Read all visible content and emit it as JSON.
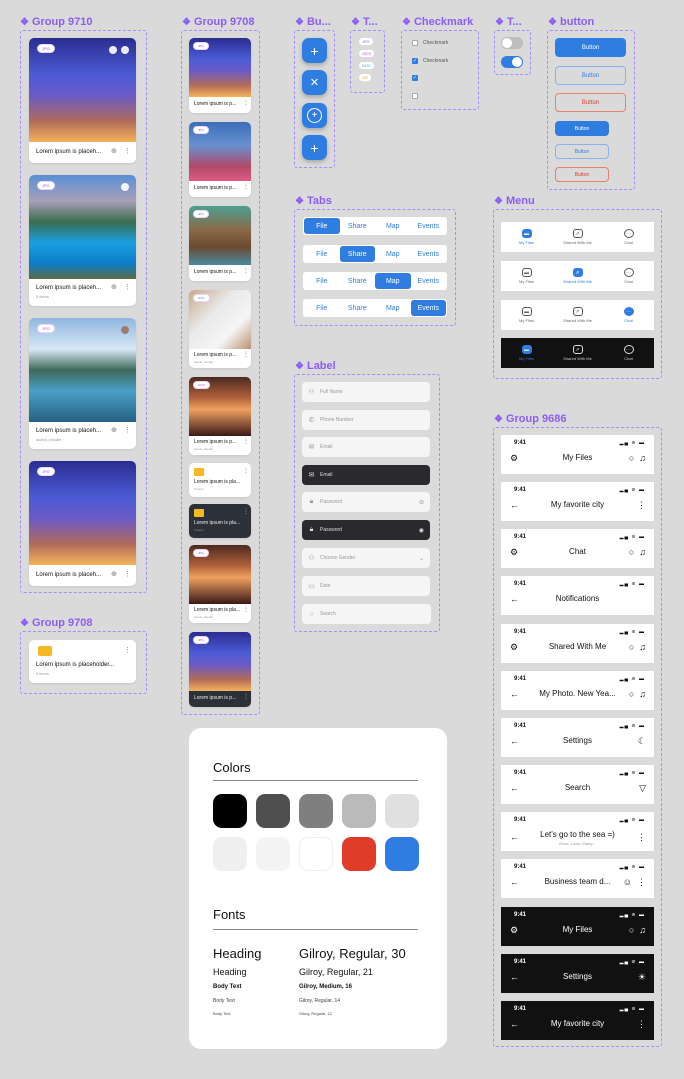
{
  "groups": {
    "g9710": "Group 9710",
    "g9708a": "Group 9708",
    "g9708b": "Group 9708",
    "buttons_fab": "Bu...",
    "tags": "T...",
    "checkmark": "Checkmark",
    "toggles": "T...",
    "button": "button",
    "tabs": "Tabs",
    "menu": "Menu",
    "label": "Label",
    "g9686": "Group 9686"
  },
  "large_cards": [
    {
      "tag": "JPG",
      "caption": "Lorem ipsum is placeh...",
      "sub": ""
    },
    {
      "tag": "JPG",
      "caption": "Lorem ipsum is placeh...",
      "sub": "5 items"
    },
    {
      "tag": "JPG",
      "caption": "Lorem ipsum is placeh...",
      "sub": "avana_baoder"
    },
    {
      "tag": "JPG",
      "caption": "Lorem ipsum is placeh...",
      "sub": ""
    }
  ],
  "folder_card": {
    "caption": "Lorem ipsum is placeholder...",
    "sub": "5 items"
  },
  "small_cards": [
    {
      "tag": "JPG",
      "caption": "Lorem ipsum is p..."
    },
    {
      "tag": "JPG",
      "caption": "Lorem ipsum is p..."
    },
    {
      "tag": "JPG",
      "caption": "Lorem ipsum is p..."
    },
    {
      "tag": "DOC",
      "caption": "Lorem ipsum is p...",
      "sub": "avana_baoder"
    },
    {
      "tag": "GIFS",
      "caption": "Lorem ipsum is p...",
      "sub": "avana_baoder"
    },
    {
      "caption": "Lorem ipsum is pla...",
      "sub": "5 items"
    },
    {
      "caption": "Lorem ipsum is pla...",
      "sub": "3 items"
    },
    {
      "tag": "JPG",
      "caption": "Lorem ipsum is pla...",
      "sub": "avana_baoder"
    },
    {
      "tag": "JPG",
      "caption": "Lorem ipsum is p..."
    }
  ],
  "tag_chips": [
    {
      "label": "JPG",
      "color": "#8b5cf6"
    },
    {
      "label": "GIFS",
      "color": "#d946ef"
    },
    {
      "label": "DOC",
      "color": "#3b9ae1"
    },
    {
      "label": "ZIP",
      "color": "#eab308"
    }
  ],
  "checkmarks": [
    {
      "label": "Checkmark",
      "checked": false
    },
    {
      "label": "Checkmark",
      "checked": true
    },
    {
      "label": "",
      "checked": true
    },
    {
      "label": "",
      "checked": false
    }
  ],
  "toggles": [
    {
      "on": false
    },
    {
      "on": true
    }
  ],
  "buttons": {
    "label": "Button"
  },
  "tabs": [
    "File",
    "Share",
    "Map",
    "Events"
  ],
  "fields": [
    {
      "placeholder": "Full Name",
      "icon": "user-icon"
    },
    {
      "placeholder": "Phone Number",
      "icon": "phone-icon"
    },
    {
      "placeholder": "Email",
      "icon": "mail-icon"
    },
    {
      "placeholder": "Email",
      "icon": "mail-icon",
      "dark": true
    },
    {
      "placeholder": "Password",
      "icon": "lock-icon"
    },
    {
      "placeholder": "Password",
      "icon": "lock-icon",
      "dark": true
    },
    {
      "placeholder": "Choose Gender",
      "icon": "gender-icon"
    },
    {
      "placeholder": "Date",
      "icon": "calendar-icon"
    },
    {
      "placeholder": "Search",
      "icon": "search-icon"
    }
  ],
  "menu": [
    "My Files",
    "Shared With Me",
    "Chat"
  ],
  "headers": [
    {
      "time": "9:41",
      "title": "My Files"
    },
    {
      "time": "9:41",
      "title": "My favorite city"
    },
    {
      "time": "9:41",
      "title": "Chat"
    },
    {
      "time": "9:41",
      "title": "Notifications"
    },
    {
      "time": "9:41",
      "title": "Shared With Me"
    },
    {
      "time": "9:41",
      "title": "My Photo. New Yea..."
    },
    {
      "time": "9:41",
      "title": "Settings"
    },
    {
      "time": "9:41",
      "title": "Search"
    },
    {
      "time": "9:41",
      "title": "Let's go to the sea =)",
      "subtitle": "Esna, Louis, Marry..."
    },
    {
      "time": "9:41",
      "title": "Business team d..."
    },
    {
      "time": "9:41",
      "title": "My Files"
    },
    {
      "time": "9:41",
      "title": "Settings"
    },
    {
      "time": "9:41",
      "title": "My favorite city"
    }
  ],
  "styleguide": {
    "colors_title": "Colors",
    "colors": [
      "#000000",
      "#4f4f4f",
      "#7f7f7f",
      "#bababa",
      "#e0e0e0",
      "#efefef",
      "#f4f4f4",
      "#ffffff",
      "#e03c2a",
      "#2f7de1"
    ],
    "fonts_title": "Fonts",
    "fonts": [
      {
        "name": "Heading",
        "spec": "Gilroy, Regular, 30"
      },
      {
        "name": "Heading",
        "spec": "Gilroy, Regular, 21"
      },
      {
        "name": "Body Text",
        "spec": "Gilroy, Medium, 16"
      },
      {
        "name": "Body Text",
        "spec": "Gilroy, Regular, 14"
      },
      {
        "name": "Body Text",
        "spec": "Gilroy, Regular, 12"
      }
    ]
  }
}
